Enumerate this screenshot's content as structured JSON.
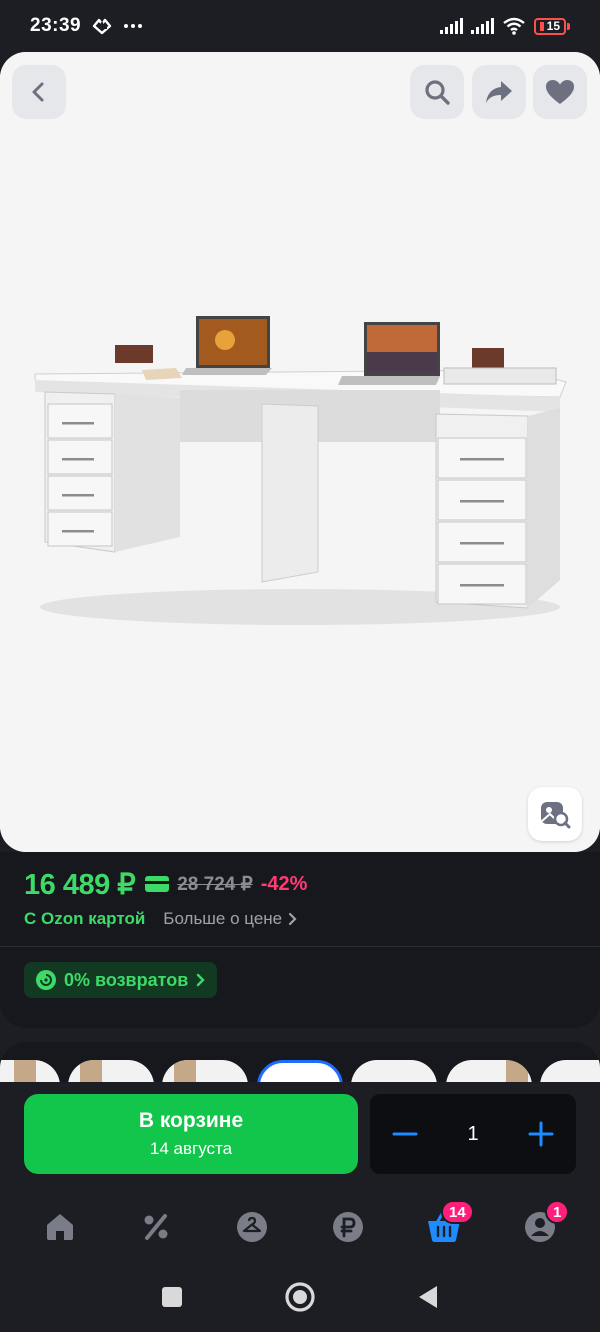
{
  "status_bar": {
    "time": "23:39",
    "extra_icons": [
      "heart-pulse-icon",
      "more-dots-icon"
    ],
    "battery_level": "15",
    "icons": [
      "signal-icon",
      "signal-icon",
      "wifi-icon",
      "battery-icon"
    ]
  },
  "product_image": {
    "alt": "desk-with-two-pedestals",
    "buttons": [
      "back-icon",
      "search-icon",
      "share-icon",
      "heart-icon",
      "visual-search-icon"
    ]
  },
  "price": {
    "current": "16 489 ₽",
    "old": "28 724 ₽",
    "discount": "-42%",
    "ozon_card_label": "С Ozon картой",
    "more_about_price": "Больше о цене",
    "returns_badge": "0% возвратов"
  },
  "actions": {
    "cart_label": "В корзине",
    "delivery_date": "14 августа",
    "quantity": "1"
  },
  "tabbar": {
    "items": [
      {
        "name": "home",
        "icon": "home-icon"
      },
      {
        "name": "promo",
        "icon": "percent-icon"
      },
      {
        "name": "fresh",
        "icon": "hanger-icon"
      },
      {
        "name": "finance",
        "icon": "ruble-icon"
      },
      {
        "name": "cart",
        "icon": "basket-icon",
        "badge": "14",
        "active": true
      },
      {
        "name": "profile",
        "icon": "user-icon",
        "badge": "1"
      }
    ]
  },
  "colors": {
    "accent_green": "#3dda67",
    "cart_green": "#11c64a",
    "discount_pink": "#ff3b73",
    "active_blue": "#1e8cff",
    "badge_pink": "#ff1f7a"
  }
}
